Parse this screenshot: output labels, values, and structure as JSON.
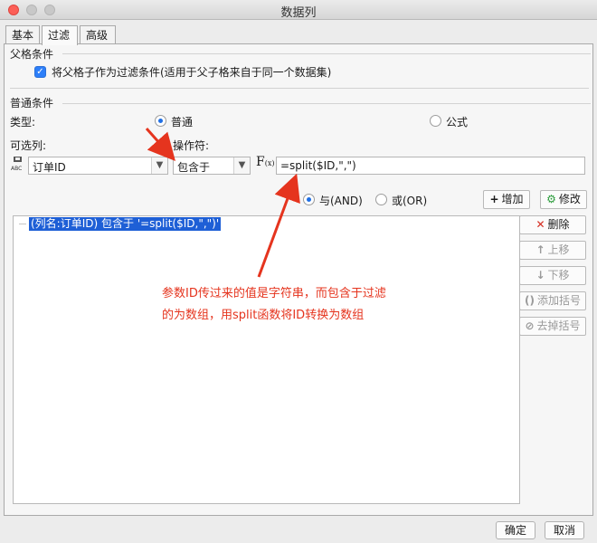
{
  "window": {
    "title": "数据列"
  },
  "tabs": [
    {
      "label": "基本"
    },
    {
      "label": "过滤"
    },
    {
      "label": "高级"
    }
  ],
  "parent_condition": {
    "heading": "父格条件",
    "checkbox_label": "将父格子作为过滤条件(适用于父子格来自于同一个数据集)",
    "checked": true
  },
  "normal_condition": {
    "heading": "普通条件",
    "type_label": "类型:",
    "type_options": [
      "普通",
      "公式"
    ],
    "selected_type": "普通",
    "column_label": "可选列:",
    "operator_label": "操作符:",
    "column_value": "订单ID",
    "operator_value": "包含于",
    "formula_value": "=split($ID,\",\")",
    "logic_options": [
      "与(AND)",
      "或(OR)"
    ],
    "selected_logic": "与(AND)",
    "add_label": "增加",
    "modify_label": "修改"
  },
  "conditions": [
    {
      "text": "(列名:订单ID) 包含于 '=split($ID,\",\")'"
    }
  ],
  "side_buttons": {
    "delete": "删除",
    "up": "上移",
    "down": "下移",
    "add_bracket": "添加括号",
    "remove_bracket": "去掉括号"
  },
  "annotation": {
    "line1": "参数ID传过来的值是字符串，而包含于过滤",
    "line2": "的为数组，用split函数将ID转换为数组",
    "color": "#e5341e"
  },
  "footer": {
    "ok": "确定",
    "cancel": "取消"
  }
}
